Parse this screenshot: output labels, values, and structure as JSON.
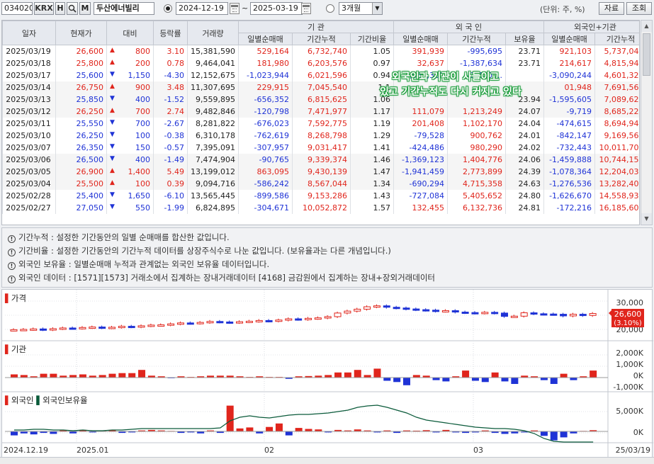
{
  "toolbar": {
    "code": "034020",
    "market": "KRX",
    "btn_h": "H",
    "btn_m": "M",
    "name": "두산에너빌리",
    "date_from": "2024-12-19",
    "tilde": "~",
    "date_to": "2025-03-19",
    "period": "3개월",
    "unit": "(단위: 주, %)",
    "data_btn": "자료",
    "query_btn": "조회",
    "search_icon": "magnifier-icon",
    "calendar_icon": "calendar-icon",
    "dropdown_icon": "chevron-down-icon"
  },
  "table": {
    "groups": [
      "기 관",
      "외 국 인",
      "외국인+기관"
    ],
    "headers": [
      "일자",
      "현재가",
      "대비",
      "등락률",
      "거래량"
    ],
    "sub_headers": [
      "일별순매매",
      "기간누적",
      "기간비율",
      "일별순매매",
      "기간누적",
      "보유율",
      "일별순매매",
      "기간누적"
    ],
    "rows": [
      {
        "date": "2025/03/19",
        "price": "26,600",
        "dir": "up",
        "diff": "800",
        "rate": "3.10",
        "vol": "15,381,590",
        "inst_day": "529,164",
        "inst_cum": "6,732,740",
        "inst_ratio": "1.05",
        "for_day": "391,939",
        "for_cum": "-995,695",
        "for_hold": "23.71",
        "sum_day": "921,103",
        "sum_cum": "5,737,045"
      },
      {
        "date": "2025/03/18",
        "price": "25,800",
        "dir": "up",
        "diff": "200",
        "rate": "0.78",
        "vol": "9,464,041",
        "inst_day": "181,980",
        "inst_cum": "6,203,576",
        "inst_ratio": "0.97",
        "for_day": "32,637",
        "for_cum": "-1,387,634",
        "for_hold": "23.71",
        "sum_day": "214,617",
        "sum_cum": "4,815,942"
      },
      {
        "date": "2025/03/17",
        "price": "25,600",
        "dir": "dn",
        "diff": "1,150",
        "rate": "-4.30",
        "vol": "12,152,675",
        "inst_day": "-1,023,944",
        "inst_cum": "6,021,596",
        "inst_ratio": "0.94",
        "for_day": "-2,066,300",
        "for_cum": "-1,420,...",
        "for_hold": "",
        "sum_day": "-3,090,244",
        "sum_cum": "4,601,325"
      },
      {
        "date": "2025/03/14",
        "price": "26,750",
        "dir": "up",
        "diff": "900",
        "rate": "3.48",
        "vol": "11,307,695",
        "inst_day": "229,915",
        "inst_cum": "7,045,540",
        "inst_ratio": "1.1",
        "for_day": "",
        "for_cum": "",
        "for_hold": "",
        "sum_day": "01,948",
        "sum_cum": "7,691,569"
      },
      {
        "date": "2025/03/13",
        "price": "25,850",
        "dir": "dn",
        "diff": "400",
        "rate": "-1.52",
        "vol": "9,559,895",
        "inst_day": "-656,352",
        "inst_cum": "6,815,625",
        "inst_ratio": "1.06",
        "for_day": "",
        "for_cum": "",
        "for_hold": "23.94",
        "sum_day": "-1,595,605",
        "sum_cum": "7,089,621"
      },
      {
        "date": "2025/03/12",
        "price": "26,250",
        "dir": "up",
        "diff": "700",
        "rate": "2.74",
        "vol": "9,482,846",
        "inst_day": "-120,798",
        "inst_cum": "7,471,977",
        "inst_ratio": "1.17",
        "for_day": "111,079",
        "for_cum": "1,213,249",
        "for_hold": "24.07",
        "sum_day": "-9,719",
        "sum_cum": "8,685,226"
      },
      {
        "date": "2025/03/11",
        "price": "25,550",
        "dir": "dn",
        "diff": "700",
        "rate": "-2.67",
        "vol": "8,281,822",
        "inst_day": "-676,023",
        "inst_cum": "7,592,775",
        "inst_ratio": "1.19",
        "for_day": "201,408",
        "for_cum": "1,102,170",
        "for_hold": "24.04",
        "sum_day": "-474,615",
        "sum_cum": "8,694,945"
      },
      {
        "date": "2025/03/10",
        "price": "26,250",
        "dir": "dn",
        "diff": "100",
        "rate": "-0.38",
        "vol": "6,310,178",
        "inst_day": "-762,619",
        "inst_cum": "8,268,798",
        "inst_ratio": "1.29",
        "for_day": "-79,528",
        "for_cum": "900,762",
        "for_hold": "24.01",
        "sum_day": "-842,147",
        "sum_cum": "9,169,560"
      },
      {
        "date": "2025/03/07",
        "price": "26,350",
        "dir": "dn",
        "diff": "150",
        "rate": "-0.57",
        "vol": "7,395,091",
        "inst_day": "-307,957",
        "inst_cum": "9,031,417",
        "inst_ratio": "1.41",
        "for_day": "-424,486",
        "for_cum": "980,290",
        "for_hold": "24.02",
        "sum_day": "-732,443",
        "sum_cum": "10,011,707"
      },
      {
        "date": "2025/03/06",
        "price": "26,500",
        "dir": "dn",
        "diff": "400",
        "rate": "-1.49",
        "vol": "7,474,904",
        "inst_day": "-90,765",
        "inst_cum": "9,339,374",
        "inst_ratio": "1.46",
        "for_day": "-1,369,123",
        "for_cum": "1,404,776",
        "for_hold": "24.06",
        "sum_day": "-1,459,888",
        "sum_cum": "10,744,150"
      },
      {
        "date": "2025/03/05",
        "price": "26,900",
        "dir": "up",
        "diff": "1,400",
        "rate": "5.49",
        "vol": "13,199,012",
        "inst_day": "863,095",
        "inst_cum": "9,430,139",
        "inst_ratio": "1.47",
        "for_day": "-1,941,459",
        "for_cum": "2,773,899",
        "for_hold": "24.39",
        "sum_day": "-1,078,364",
        "sum_cum": "12,204,038"
      },
      {
        "date": "2025/03/04",
        "price": "25,500",
        "dir": "up",
        "diff": "100",
        "rate": "0.39",
        "vol": "9,094,716",
        "inst_day": "-586,242",
        "inst_cum": "8,567,044",
        "inst_ratio": "1.34",
        "for_day": "-690,294",
        "for_cum": "4,715,358",
        "for_hold": "24.63",
        "sum_day": "-1,276,536",
        "sum_cum": "13,282,402"
      },
      {
        "date": "2025/02/28",
        "price": "25,400",
        "dir": "dn",
        "diff": "1,650",
        "rate": "-6.10",
        "vol": "13,565,445",
        "inst_day": "-899,586",
        "inst_cum": "9,153,286",
        "inst_ratio": "1.43",
        "for_day": "-727,084",
        "for_cum": "5,405,652",
        "for_hold": "24.80",
        "sum_day": "-1,626,670",
        "sum_cum": "14,558,938"
      },
      {
        "date": "2025/02/27",
        "price": "27,050",
        "dir": "dn",
        "diff": "550",
        "rate": "-1.99",
        "vol": "6,824,895",
        "inst_day": "-304,671",
        "inst_cum": "10,052,872",
        "inst_ratio": "1.57",
        "for_day": "132,455",
        "for_cum": "6,132,736",
        "for_hold": "24.81",
        "sum_day": "-172,216",
        "sum_cum": "16,185,608"
      }
    ]
  },
  "overlay": {
    "line1": "외국인과 기관이 사들이고",
    "line2": "있고 기간누적도 다시 커지고 있다"
  },
  "notes": [
    "기간누적 : 설정한 기간동안의 일별 순매매를 합산한 값입니다.",
    "기간비율 : 설정한 기간동안의 기간누적 데이터를 상장주식수로 나눈 값입니다. (보유율과는 다른 개념입니다.)",
    "외국인 보유율 : 일별순매매 누적과 관계없는 외국인 보유율 데이터입니다.",
    "외국인 데이터 : [1571][1573] 거래소에서 집계하는 장내거래데이터  [4168] 금감원에서 집계하는 장내+장외거래데이터"
  ],
  "note_icon": "info-icon",
  "chart": {
    "price_label": "가격",
    "inst_label": "기관",
    "for_label": "외국인",
    "hold_label": "외국인보유율",
    "price_ticks": [
      "30,000",
      "25,000",
      "20,000"
    ],
    "price_current": "26,600",
    "price_current_rate": "(3.10%)",
    "inst_ticks": [
      "2,000K",
      "1,000K",
      "0K",
      "-1,000K"
    ],
    "for_ticks": [
      "5,000K",
      "0K"
    ],
    "x_labels": [
      "2024.12.19",
      "2025.01",
      "02",
      "03",
      "25/03/19"
    ],
    "up_color": "#e0251c",
    "down_color": "#1f33d6"
  }
}
